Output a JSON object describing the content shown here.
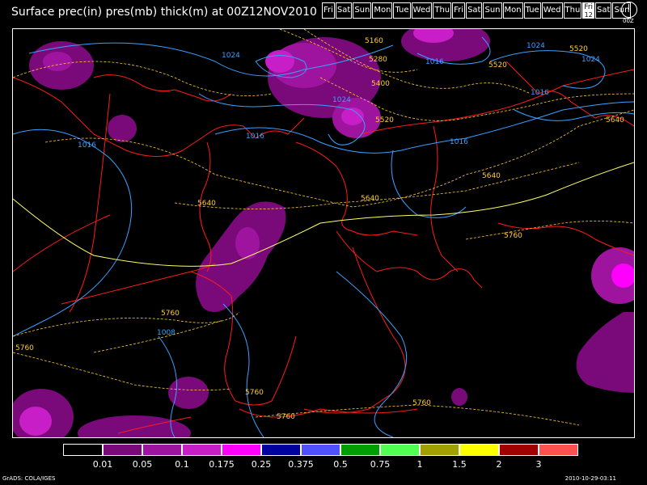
{
  "title": "Surface prec(in) pres(mb) thick(m) at 00Z12NOV2010",
  "days": [
    {
      "label": "Fri"
    },
    {
      "label": "Sat"
    },
    {
      "label": "Sun"
    },
    {
      "label": "Mon"
    },
    {
      "label": "Tue"
    },
    {
      "label": "Wed"
    },
    {
      "label": "Thu"
    },
    {
      "label": "Fri"
    },
    {
      "label": "Sat"
    },
    {
      "label": "Sun"
    },
    {
      "label": "Mon"
    },
    {
      "label": "Tue"
    },
    {
      "label": "Wed"
    },
    {
      "label": "Thu"
    },
    {
      "label": "Fri",
      "sub": "12",
      "active": true
    },
    {
      "label": "Sat"
    },
    {
      "label": "Sun"
    }
  ],
  "clock_label": "00Z",
  "legend": {
    "colors": [
      "#000000",
      "#7a0a7a",
      "#9e149e",
      "#c81ec8",
      "#ff00ff",
      "#00009e",
      "#5050ff",
      "#009e00",
      "#50ff50",
      "#a0a000",
      "#ffff00",
      "#a00000",
      "#ff5050"
    ],
    "labels": [
      "0.01",
      "0.05",
      "0.1",
      "0.175",
      "0.25",
      "0.375",
      "0.5",
      "0.75",
      "1",
      "1.5",
      "2",
      "3"
    ]
  },
  "pressure_labels": [
    "1024",
    "1024",
    "1024",
    "1016",
    "1016",
    "1016",
    "1016",
    "1016",
    "1008",
    "1024"
  ],
  "thickness_labels": [
    "5160",
    "5280",
    "5400",
    "5520",
    "5520",
    "5640",
    "5640",
    "5640",
    "5640",
    "5760",
    "5760",
    "5760",
    "5760",
    "5760",
    "5760",
    "5520"
  ],
  "colors": {
    "coast": "#ff1a1a",
    "pressure": "#3aa0ff",
    "thickness_warm": "#ffcc33",
    "thickness_line": "#ffff66",
    "precip_light": "#7a0a7a",
    "precip_mid": "#9e149e",
    "precip_heavy": "#ff00ff"
  },
  "credit": "GrADS: COLA/IGES",
  "timestamp": "2010-10-29-03:11"
}
